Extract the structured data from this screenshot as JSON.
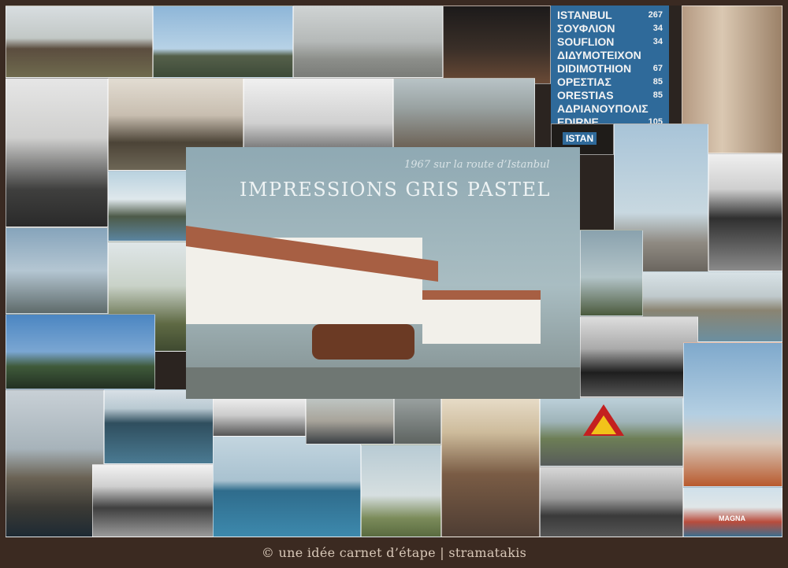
{
  "collage": {
    "subtitle": "1967  sur la route d’Istanbul",
    "title": "IMPRESSIONS  GRIS PASTEL"
  },
  "road_sign": {
    "lines": [
      {
        "text": "ISTANBUL",
        "km": "267"
      },
      {
        "text": "ΣΟΥΦΛΙΟΝ",
        "km": "34"
      },
      {
        "text": "SOUFLION",
        "km": "34"
      },
      {
        "text": "ΔΙΔΥΜΟΤΕΙΧΟΝ",
        "km": ""
      },
      {
        "text": "DIDIMOTHION",
        "km": "67"
      },
      {
        "text": "ΟΡΕΣΤΙΑΣ",
        "km": "85"
      },
      {
        "text": "ORESTIAS",
        "km": "85"
      },
      {
        "text": "ΑΔΡΙΑΝΟΥΠΟΛΙΣ",
        "km": ""
      },
      {
        "text": "EDIRNE",
        "km": "105"
      }
    ],
    "small_sign": "ISTAN"
  },
  "boat_name": "MAGNA",
  "footer": {
    "caption": "© une idée carnet d’étape  |  stramatakis"
  },
  "colors": {
    "border": "#3b2a21",
    "sign_blue": "#2f6a9a",
    "roof": "#a75f43"
  }
}
